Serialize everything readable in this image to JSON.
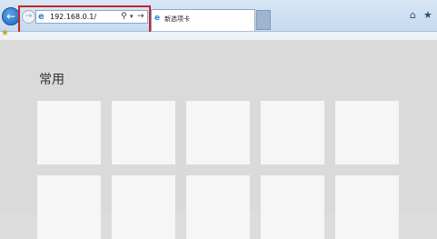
{
  "address_bar": {
    "url": "192.168.0.1/",
    "search_icon": "search-icon",
    "dropdown_icon": "chevron-down-icon",
    "go_icon": "arrow-right-icon"
  },
  "tab": {
    "label": "新选项卡"
  },
  "toolbar": {
    "home_icon": "home-icon",
    "favorites_icon": "star-icon"
  },
  "new_tab_page": {
    "section_title": "常用",
    "tile_count_visible": 10
  },
  "colors": {
    "highlight_border": "#c0272d",
    "page_background": "#dadada",
    "tile_background": "#f6f6f6"
  }
}
